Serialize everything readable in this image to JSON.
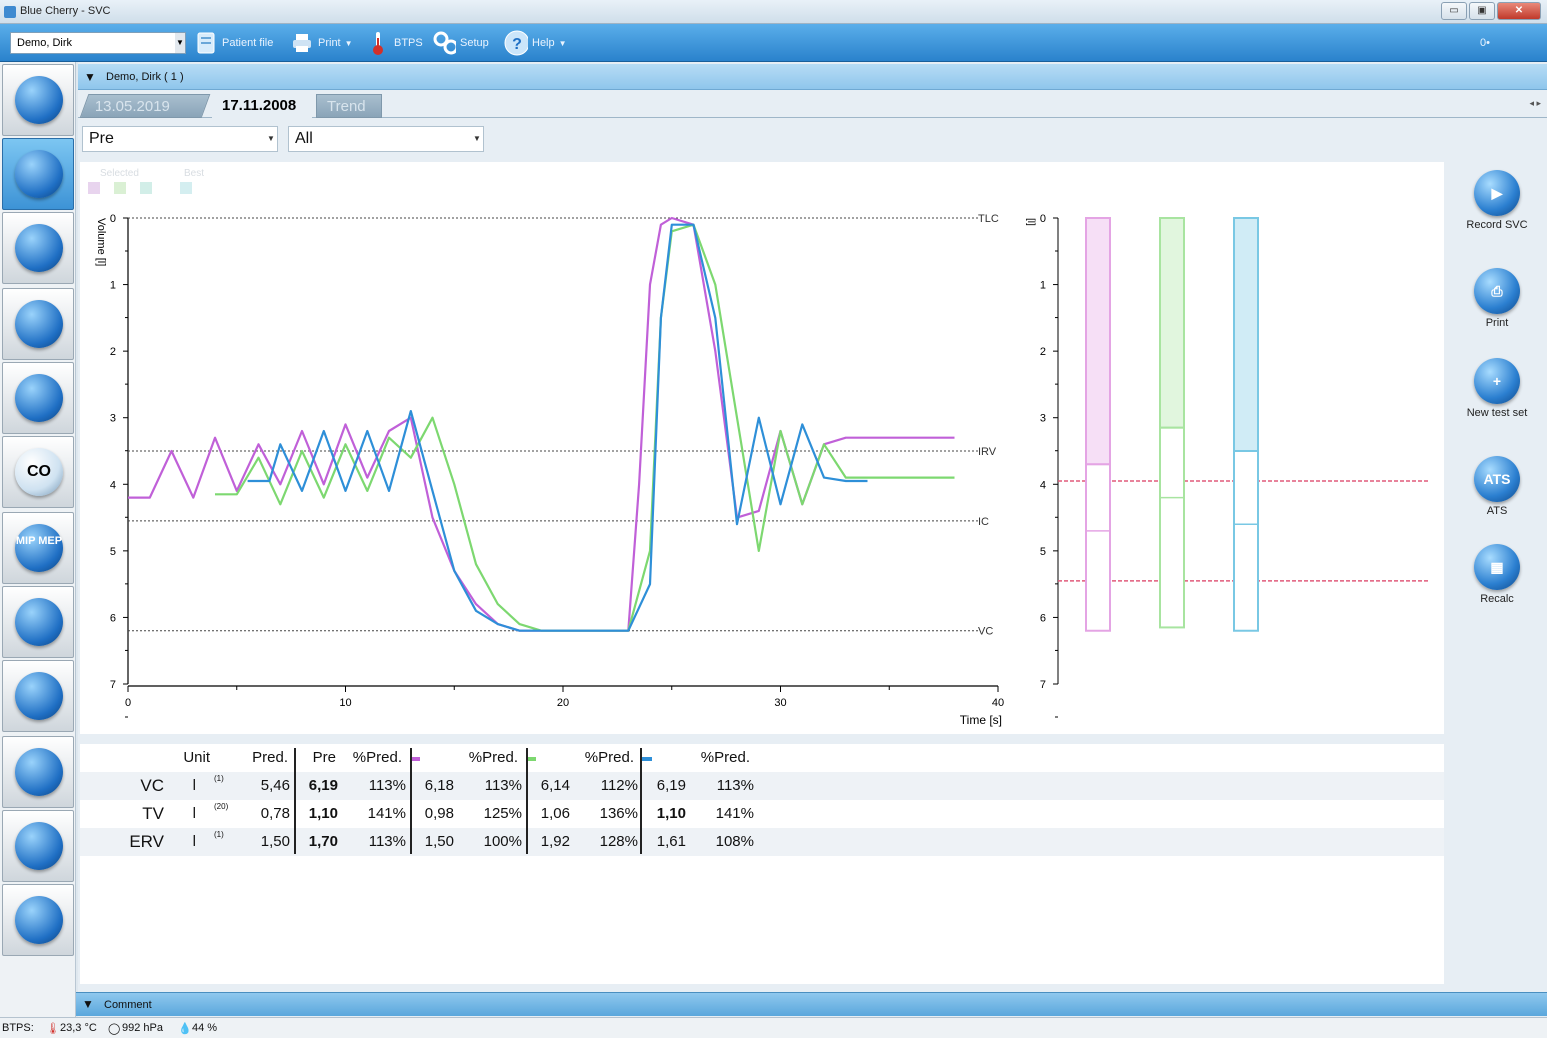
{
  "window": {
    "title": "Blue Cherry - SVC",
    "min": "▭",
    "max": "▣",
    "close": "✕"
  },
  "toolbar": {
    "patient": "Demo, Dirk",
    "patient_file": "Patient file",
    "print": "Print",
    "btps": "BTPS",
    "setup": "Setup",
    "help": "Help",
    "right_indicator": "0•"
  },
  "sidebar": {
    "items": [
      {
        "name": "patient-data",
        "label": ""
      },
      {
        "name": "spirometry",
        "label": ""
      },
      {
        "name": "flow-volume",
        "label": ""
      },
      {
        "name": "bodyplethysmography",
        "label": ""
      },
      {
        "name": "compliance",
        "label": ""
      },
      {
        "name": "co-diffusion",
        "label": "CO"
      },
      {
        "name": "mip-mep",
        "label": "MIP MEP"
      },
      {
        "name": "provocation",
        "label": ""
      },
      {
        "name": "bronchodilation",
        "label": ""
      },
      {
        "name": "ergospirometry",
        "label": ""
      },
      {
        "name": "rhinomanometry",
        "label": ""
      },
      {
        "name": "exit",
        "label": ""
      }
    ]
  },
  "patient_header": {
    "name": "Demo, Dirk ( 1 )"
  },
  "tabs": [
    {
      "label": "13.05.2019",
      "active": false
    },
    {
      "label": "17.11.2008",
      "active": true
    },
    {
      "label": "Trend",
      "active": false
    }
  ],
  "filters": {
    "phase": "Pre",
    "trials": "All"
  },
  "legend": {
    "selected_label": "Selected",
    "best_label": "Best"
  },
  "chart_data": {
    "type": "line",
    "xlabel": "Time [s]",
    "ylabel": "Volume [l]",
    "xlim": [
      0,
      40
    ],
    "ylim": [
      0,
      7
    ],
    "y_inverted": true,
    "x_ticks": [
      "0",
      "10",
      "20",
      "30",
      "40"
    ],
    "y_ticks": [
      "0",
      "1",
      "2",
      "3",
      "4",
      "5",
      "6",
      "7"
    ],
    "reference_lines": [
      {
        "label": "TLC",
        "y": 0
      },
      {
        "label": "IRV",
        "y": 3.5
      },
      {
        "label": "IC",
        "y": 4.55
      },
      {
        "label": "VC",
        "y": 6.2
      }
    ],
    "series": [
      {
        "color": "#c060d8",
        "x": [
          0,
          1,
          2,
          3,
          4,
          5,
          6,
          7,
          8,
          9,
          10,
          11,
          12,
          13,
          14,
          15,
          16,
          17,
          18,
          19,
          20,
          21,
          22,
          23,
          23.5,
          24,
          24.5,
          25,
          26,
          27,
          28,
          29,
          30,
          31,
          32,
          33,
          34,
          35,
          36,
          37,
          38
        ],
        "y": [
          4.2,
          4.2,
          3.5,
          4.2,
          3.3,
          4.1,
          3.4,
          4.0,
          3.2,
          4.0,
          3.1,
          3.9,
          3.2,
          3.0,
          4.5,
          5.3,
          5.8,
          6.1,
          6.2,
          6.2,
          6.2,
          6.2,
          6.2,
          6.2,
          4.0,
          1.0,
          0.1,
          0,
          0.1,
          2.0,
          4.5,
          4.4,
          3.2,
          4.3,
          3.4,
          3.3,
          3.3,
          3.3,
          3.3,
          3.3,
          3.3
        ]
      },
      {
        "color": "#7dd870",
        "x": [
          4,
          5,
          6,
          7,
          8,
          9,
          10,
          11,
          12,
          13,
          14,
          15,
          16,
          17,
          18,
          19,
          20,
          21,
          22,
          23,
          24,
          24.5,
          25,
          26,
          27,
          28,
          29,
          30,
          31,
          32,
          33,
          34,
          35,
          36,
          37,
          38
        ],
        "y": [
          4.15,
          4.15,
          3.6,
          4.3,
          3.5,
          4.2,
          3.4,
          4.1,
          3.3,
          3.6,
          3.0,
          4.0,
          5.2,
          5.8,
          6.1,
          6.2,
          6.2,
          6.2,
          6.2,
          6.2,
          5.0,
          1.5,
          0.2,
          0.1,
          1.0,
          3.0,
          5.0,
          3.2,
          4.3,
          3.4,
          3.9,
          3.9,
          3.9,
          3.9,
          3.9,
          3.9
        ]
      },
      {
        "color": "#2e8fd8",
        "x": [
          5.5,
          6.5,
          7,
          8,
          9,
          10,
          11,
          12,
          13,
          14,
          15,
          16,
          17,
          18,
          19,
          20,
          21,
          22,
          23,
          24,
          24.5,
          25,
          26,
          27,
          28,
          29,
          30,
          31,
          32,
          33,
          34
        ],
        "y": [
          3.95,
          3.95,
          3.4,
          4.1,
          3.2,
          4.1,
          3.2,
          4.1,
          2.9,
          4.1,
          5.3,
          5.9,
          6.1,
          6.2,
          6.2,
          6.2,
          6.2,
          6.2,
          6.2,
          5.5,
          1.5,
          0.1,
          0.1,
          1.5,
          4.6,
          3.0,
          4.3,
          3.1,
          3.9,
          3.95,
          3.95
        ]
      }
    ]
  },
  "bars": {
    "ylabel": "[l]",
    "y_ticks": [
      "0",
      "1",
      "2",
      "3",
      "4",
      "5",
      "6",
      "7"
    ],
    "ref_lines": [
      3.95,
      5.45
    ],
    "columns": [
      {
        "color": "#e4a4e4",
        "top": 0,
        "split": 3.7,
        "mark": 4.7,
        "bottom": 6.2
      },
      {
        "color": "#a8e4a0",
        "top": 0,
        "split": 3.15,
        "mark": 4.2,
        "bottom": 6.15
      },
      {
        "color": "#79c8e4",
        "top": 0,
        "split": 3.5,
        "mark": 4.6,
        "bottom": 6.2
      }
    ]
  },
  "right_actions": [
    {
      "name": "record-svc",
      "label": "Record SVC",
      "glyph": "▶"
    },
    {
      "name": "print",
      "label": "Print",
      "glyph": "⎙"
    },
    {
      "name": "new-test-set",
      "label": "New test set",
      "glyph": "+"
    },
    {
      "name": "ats",
      "label": "ATS",
      "glyph": "ATS"
    },
    {
      "name": "recalc",
      "label": "Recalc",
      "glyph": "▦"
    }
  ],
  "results_table": {
    "headers": {
      "unit": "Unit",
      "pred": "Pred.",
      "pre": "Pre",
      "pct": "%Pred."
    },
    "header_swatches": [
      "#c060d8",
      "#7dd870",
      "#2e8fd8"
    ],
    "rows": [
      {
        "param": "VC",
        "unit": "l",
        "note": "(1)",
        "pred": "5,46",
        "pre": "6,19",
        "pre_pct": "113%",
        "t1": "6,18",
        "t1_pct": "113%",
        "t2": "6,14",
        "t2_pct": "112%",
        "t3": "6,19",
        "t3_pct": "113%"
      },
      {
        "param": "TV",
        "unit": "l",
        "note": "(20)",
        "pred": "0,78",
        "pre": "1,10",
        "pre_pct": "141%",
        "t1": "0,98",
        "t1_pct": "125%",
        "t2": "1,06",
        "t2_pct": "136%",
        "t3": "1,10",
        "t3_pct": "141%"
      },
      {
        "param": "ERV",
        "unit": "l",
        "note": "(1)",
        "pred": "1,50",
        "pre": "1,70",
        "pre_pct": "113%",
        "t1": "1,50",
        "t1_pct": "100%",
        "t2": "1,92",
        "t2_pct": "128%",
        "t3": "1,61",
        "t3_pct": "108%"
      }
    ],
    "bold_t3_rows": [
      1
    ]
  },
  "comment": {
    "label": "Comment"
  },
  "status": {
    "btps": "BTPS:",
    "temp": "23,3 °C",
    "pressure": "992 hPa",
    "humidity": "44 %"
  }
}
